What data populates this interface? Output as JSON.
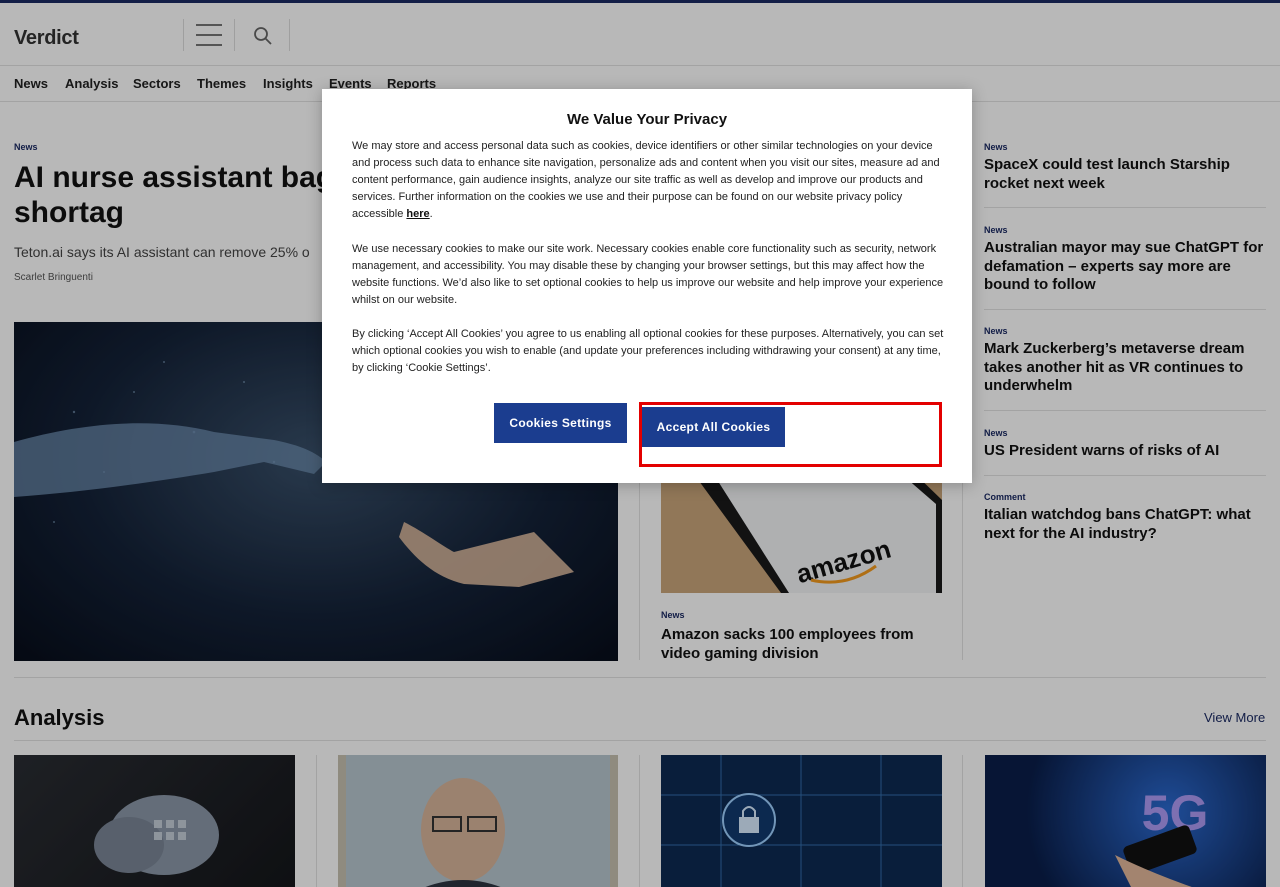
{
  "header": {
    "logo": "Verdict"
  },
  "nav": [
    "News",
    "Analysis",
    "Sectors",
    "Themes",
    "Insights",
    "Events",
    "Reports"
  ],
  "lead": {
    "tag": "News",
    "title": "AI nurse assistant bags healthcare staff shortag",
    "standfirst": "Teton.ai says its AI assistant can remove 25% o",
    "author": "Scarlet Bringuenti"
  },
  "mid_story": {
    "image_text": "amazon",
    "tag": "News",
    "title": "Amazon sacks 100 employees from video gaming division"
  },
  "side_stories": [
    {
      "tag": "News",
      "title": "SpaceX could test launch Starship rocket next week"
    },
    {
      "tag": "News",
      "title": "Australian mayor may sue ChatGPT for defamation – experts say more are bound to follow"
    },
    {
      "tag": "News",
      "title": "Mark Zuckerberg’s metaverse dream takes another hit as VR continues to underwhelm"
    },
    {
      "tag": "News",
      "title": "US President warns of risks of AI"
    },
    {
      "tag": "Comment",
      "title": "Italian watchdog bans ChatGPT: what next for the AI industry?"
    }
  ],
  "analysis": {
    "title": "Analysis",
    "view_more": "View More",
    "card4_text": "5G"
  },
  "cookie_modal": {
    "title": "We Value Your Privacy",
    "p1": "We may store and access personal data such as cookies, device identifiers or other similar technologies on your device and process such data to enhance site navigation, personalize ads and content when you visit our sites, measure ad and content performance, gain audience insights, analyze our site traffic as well as develop and improve our products and services. Further information on the cookies we use and their purpose can be found on our website privacy policy accessible",
    "link": "here",
    "period": ".",
    "p2": "We use necessary cookies to make our site work. Necessary cookies enable core functionality such as security, network management, and accessibility. You may disable these by changing your browser settings, but this may affect how the website functions. We’d also like to set optional cookies to help us improve our website and help improve your experience whilst on our website.",
    "p3": "By clicking ‘Accept All Cookies’ you agree to us enabling all optional cookies for these purposes. Alternatively, you can set which optional cookies you wish to enable (and update your preferences including withdrawing your consent) at any time, by clicking ‘Cookie Settings’.",
    "settings_button": "Cookies Settings",
    "accept_button": "Accept All Cookies"
  },
  "colors": {
    "brand": "#1b2a63",
    "button": "#1b3d8f",
    "highlight": "#e30000"
  }
}
